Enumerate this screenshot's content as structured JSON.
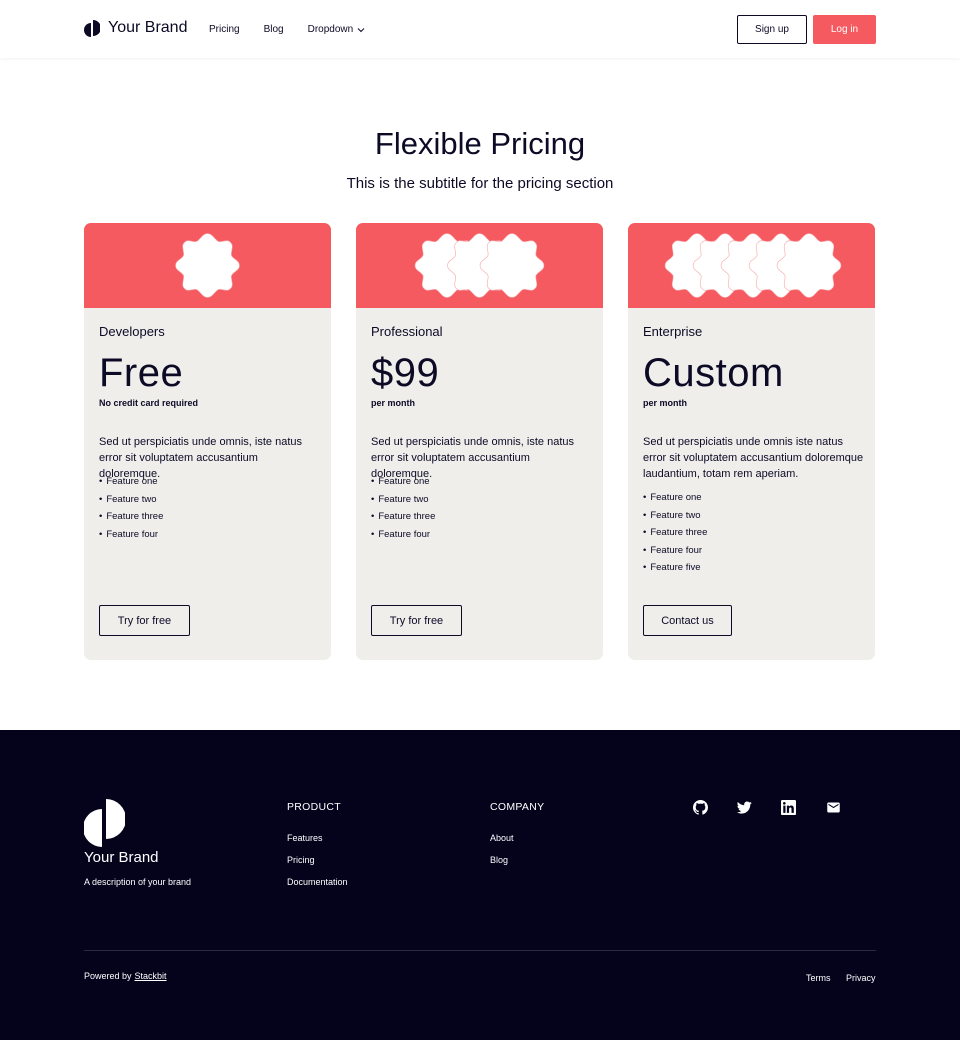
{
  "header": {
    "brand_name": "Your Brand",
    "nav": [
      "Pricing",
      "Blog",
      "Dropdown"
    ],
    "signup_label": "Sign up",
    "login_label": "Log in"
  },
  "hero": {
    "title": "Flexible Pricing",
    "subtitle": "This is the subtitle for the pricing section"
  },
  "plans": [
    {
      "name": "Developers",
      "price": "Free",
      "note": "No credit card required",
      "description": "Sed ut perspiciatis unde omnis, iste natus error sit voluptatem accusantium doloremque.",
      "features": [
        "Feature one",
        "Feature two",
        "Feature three",
        "Feature four"
      ],
      "button": "Try for free"
    },
    {
      "name": "Professional",
      "price": "$99",
      "note": "per month",
      "description": "Sed ut perspiciatis unde omnis, iste natus error sit voluptatem accusantium doloremque.",
      "features": [
        "Feature one",
        "Feature two",
        "Feature three",
        "Feature four"
      ],
      "button": "Try for free"
    },
    {
      "name": "Enterprise",
      "price": "Custom",
      "note": "per month",
      "description": "Sed ut perspiciatis unde omnis iste natus error sit voluptatem accusantium doloremque laudantium, totam rem aperiam.",
      "features": [
        "Feature one",
        "Feature two",
        "Feature three",
        "Feature four",
        "Feature five"
      ],
      "button": "Contact us"
    }
  ],
  "footer": {
    "brand_name": "Your Brand",
    "description": "A description of your brand",
    "product_title": "PRODUCT",
    "product_links": [
      "Features",
      "Pricing",
      "Documentation"
    ],
    "company_title": "COMPANY",
    "company_links": [
      "About",
      "Blog"
    ],
    "social_icons": [
      "github-icon",
      "twitter-icon",
      "linkedin-icon",
      "mail-icon"
    ],
    "powered_by": "Powered by",
    "powered_link": "Stackbit",
    "legal_links": [
      "Terms",
      "Privacy"
    ]
  },
  "colors": {
    "accent": "#f55a60",
    "dark": "#0c0a25",
    "footer_bg": "#05021c",
    "card_bg": "#efeeeb"
  }
}
